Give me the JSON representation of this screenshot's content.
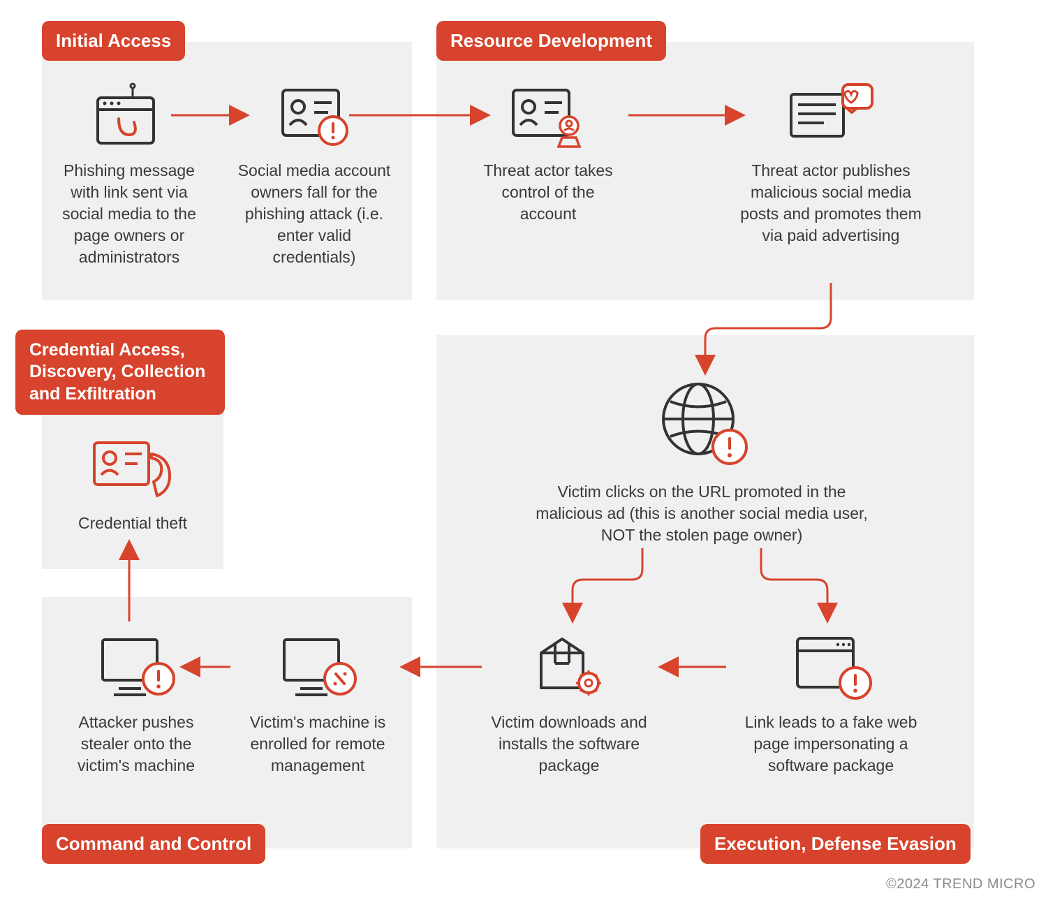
{
  "badges": {
    "initial_access": "Initial Access",
    "resource_dev": "Resource Development",
    "credential": "Credential Access, Discovery,  Collection and  Exfiltration",
    "command_control": "Command and Control",
    "execution": "Execution, Defense Evasion"
  },
  "nodes": {
    "n1": "Phishing message with link sent via social media to the page owners or administrators",
    "n2": "Social media account owners fall for the phishing attack (i.e. enter valid credentials)",
    "n3": "Threat actor takes control of the account",
    "n4": "Threat actor publishes malicious social media posts and promotes them via paid advertising",
    "n5": "Victim clicks on the URL promoted in the malicious ad (this is another social media user, NOT the stolen page owner)",
    "n6": "Link leads to a fake web page impersonating a software package",
    "n7": "Victim downloads and installs the software package",
    "n8": "Victim's machine is enrolled for remote management",
    "n9": "Attacker pushes stealer onto the victim's machine",
    "n10": "Credential theft"
  },
  "copyright": "©2024 TREND MICRO"
}
